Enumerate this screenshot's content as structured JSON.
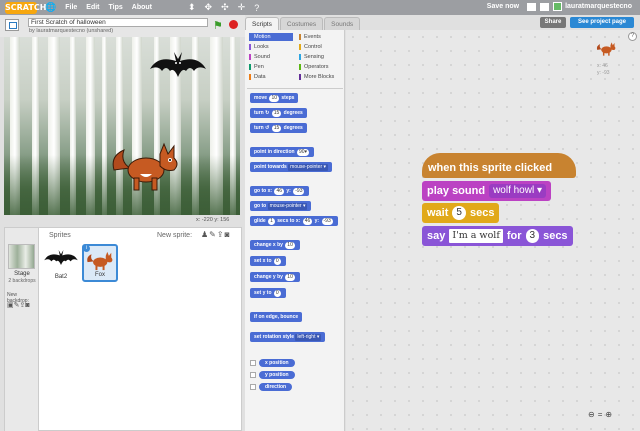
{
  "menubar": {
    "logo": "SCRATCH",
    "menus": [
      "File",
      "Edit",
      "Tips",
      "About"
    ],
    "save_now": "Save now",
    "username": "lauratmarquestecno"
  },
  "project": {
    "title": "First Scratch of halloween",
    "byline": "by lauratmarquestecno (unshared)",
    "share": "Share",
    "see_project_page": "See project page"
  },
  "stage": {
    "coords": "x: -220  y: 156"
  },
  "tabs": [
    "Scripts",
    "Costumes",
    "Sounds"
  ],
  "categories": [
    {
      "label": "Motion",
      "color": "#4a6cd4"
    },
    {
      "label": "Looks",
      "color": "#8a55d7"
    },
    {
      "label": "Sound",
      "color": "#bb42c3"
    },
    {
      "label": "Pen",
      "color": "#0e9a6c"
    },
    {
      "label": "Data",
      "color": "#ee7d16"
    },
    {
      "label": "Events",
      "color": "#c88330"
    },
    {
      "label": "Control",
      "color": "#e1a91a"
    },
    {
      "label": "Sensing",
      "color": "#2ca5e2"
    },
    {
      "label": "Operators",
      "color": "#5cb712"
    },
    {
      "label": "More Blocks",
      "color": "#632d99"
    }
  ],
  "palette": {
    "move": "move",
    "move_num": "10",
    "move_unit": "steps",
    "turn": "turn",
    "turn_num": "15",
    "degrees": "degrees",
    "point_dir": "point in direction",
    "point_dir_num": "90▾",
    "point_towards": "point towards",
    "mouse_pointer": "mouse-pointer ▾",
    "goto_xy": "go to x:",
    "x_num": "46",
    "y_label": "y:",
    "y_num": "-93",
    "goto": "go to",
    "glide": "glide",
    "glide_num": "1",
    "secs_to_x": "secs to x:",
    "change_x": "change x by",
    "change_num": "10",
    "set_x": "set x to",
    "set_num": "0",
    "change_y": "change y by",
    "set_y": "set y to",
    "bounce": "if on edge, bounce",
    "rot_style": "set rotation style",
    "rot_val": "left-right ▾",
    "rep_x": "x position",
    "rep_y": "y position",
    "rep_dir": "direction"
  },
  "sprites_pane": {
    "sprites_label": "Sprites",
    "new_sprite_label": "New sprite:",
    "stage_label": "Stage",
    "stage_backdrops": "2 backdrops",
    "new_backdrop": "New backdrop:",
    "sprites": [
      {
        "name": "Bat2",
        "icon": "bat-icon",
        "selected": false
      },
      {
        "name": "Fox",
        "icon": "fox-icon",
        "selected": true
      }
    ]
  },
  "script": {
    "hat": "when this sprite clicked",
    "play_sound": "play sound",
    "sound_name": "wolf howl",
    "wait": "wait",
    "wait_num": "5",
    "secs": "secs",
    "say": "say",
    "say_text": "I'm a wolf",
    "for": "for",
    "say_num": "3"
  },
  "sprite_info": {
    "x": "x: 46",
    "y": "y: -93"
  }
}
